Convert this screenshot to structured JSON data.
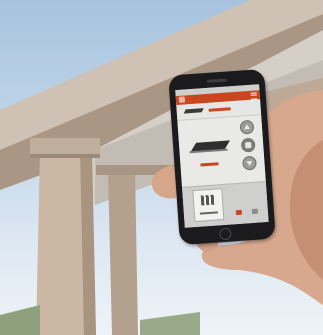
{
  "scene": {
    "description_icons": [
      "pergola-beam",
      "hand",
      "smartphone"
    ],
    "colors": {
      "sky": "#b9cfe6",
      "wood": "#c9b7a7",
      "skin": "#d7a88e",
      "app_accent": "#c9471f",
      "phone_body": "#1b1b1d"
    }
  },
  "app": {
    "controls": [
      "up-icon",
      "stop-icon",
      "down-icon"
    ],
    "tabs": [
      "awning-grid-icon",
      "timer-icon",
      "settings-icon"
    ]
  }
}
